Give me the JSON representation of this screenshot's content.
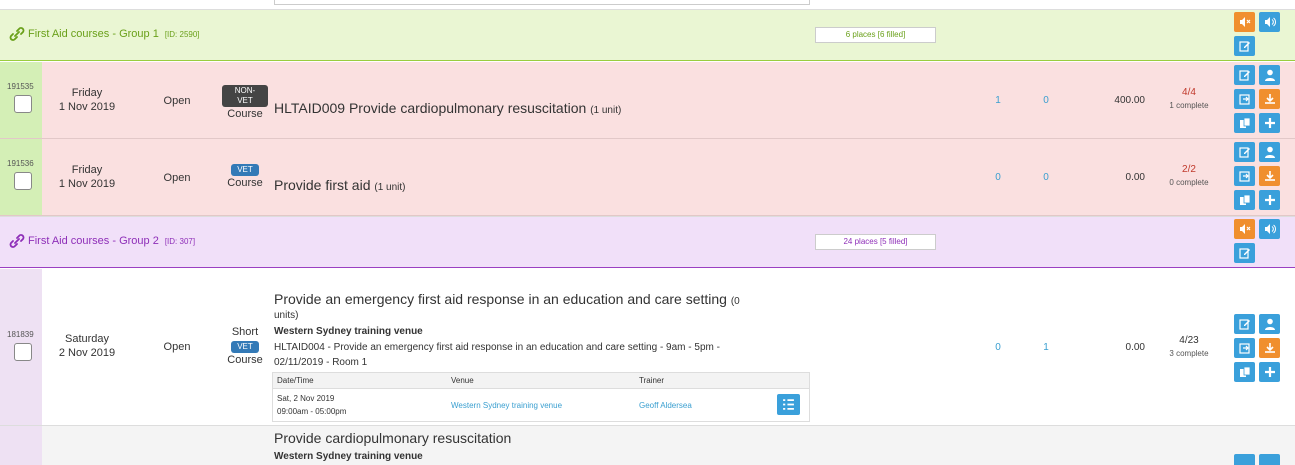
{
  "groups": [
    {
      "title": "First Aid courses - Group 1",
      "id": "[ID: 2590]",
      "places": "6 places [6 filled]"
    },
    {
      "title": "First Aid courses - Group 2",
      "id": "[ID: 307]",
      "places": "24 places [5 filled]"
    }
  ],
  "rows": [
    {
      "id": "191535",
      "day": "Friday",
      "date": "1 Nov 2019",
      "status": "Open",
      "badge": "NON-VET",
      "type": "Course",
      "name": "HLTAID009 Provide cardiopulmonary resuscitation",
      "units": "(1 unit)",
      "n1": "1",
      "n2": "0",
      "price": "400.00",
      "fill": "4/4",
      "complete": "1 complete"
    },
    {
      "id": "191536",
      "day": "Friday",
      "date": "1 Nov 2019",
      "status": "Open",
      "badge": "VET",
      "type": "Course",
      "name": "Provide first aid",
      "units": "(1 unit)",
      "n1": "0",
      "n2": "0",
      "price": "0.00",
      "fill": "2/2",
      "complete": "0 complete"
    },
    {
      "id": "181839",
      "day": "Saturday",
      "date": "2 Nov 2019",
      "status": "Open",
      "type_top": "Short",
      "badge": "VET",
      "type": "Course",
      "name_line1": "Provide an emergency first aid response in an education and care setting",
      "units_line1": "(0",
      "units_line2": "units)",
      "venue": "Western Sydney training venue",
      "detail_line1": "HLTAID004 - Provide an emergency first aid response in an education and care setting - 9am - 5pm -",
      "detail_line2": "02/11/2019 - Room 1",
      "n1": "0",
      "n2": "1",
      "price": "0.00",
      "fill": "4/23",
      "complete": "3 complete"
    },
    {
      "name": "Provide cardiopulmonary resuscitation",
      "venue": "Western Sydney training venue"
    }
  ],
  "session_table": {
    "headers": {
      "datetime": "Date/Time",
      "venue": "Venue",
      "trainer": "Trainer"
    },
    "row": {
      "date": "Sat, 2 Nov 2019",
      "time": "09:00am - 05:00pm",
      "venue": "Western Sydney training venue",
      "trainer": "Geoff Aldersea"
    }
  },
  "icons": {
    "group_link": "link-icon",
    "mute": "mute-icon",
    "sound": "sound-icon",
    "edit": "edit-icon",
    "user": "user-icon",
    "refresh": "refresh-icon",
    "download": "download-icon",
    "copy": "copy-icon",
    "add": "plus-icon",
    "list": "list-icon"
  },
  "colors": {
    "blue": "#3aa0db",
    "orange": "#f08f2e",
    "green_group": "#6aa01a",
    "purple_group": "#8e2eb8",
    "red_fill": "#c0392b"
  }
}
